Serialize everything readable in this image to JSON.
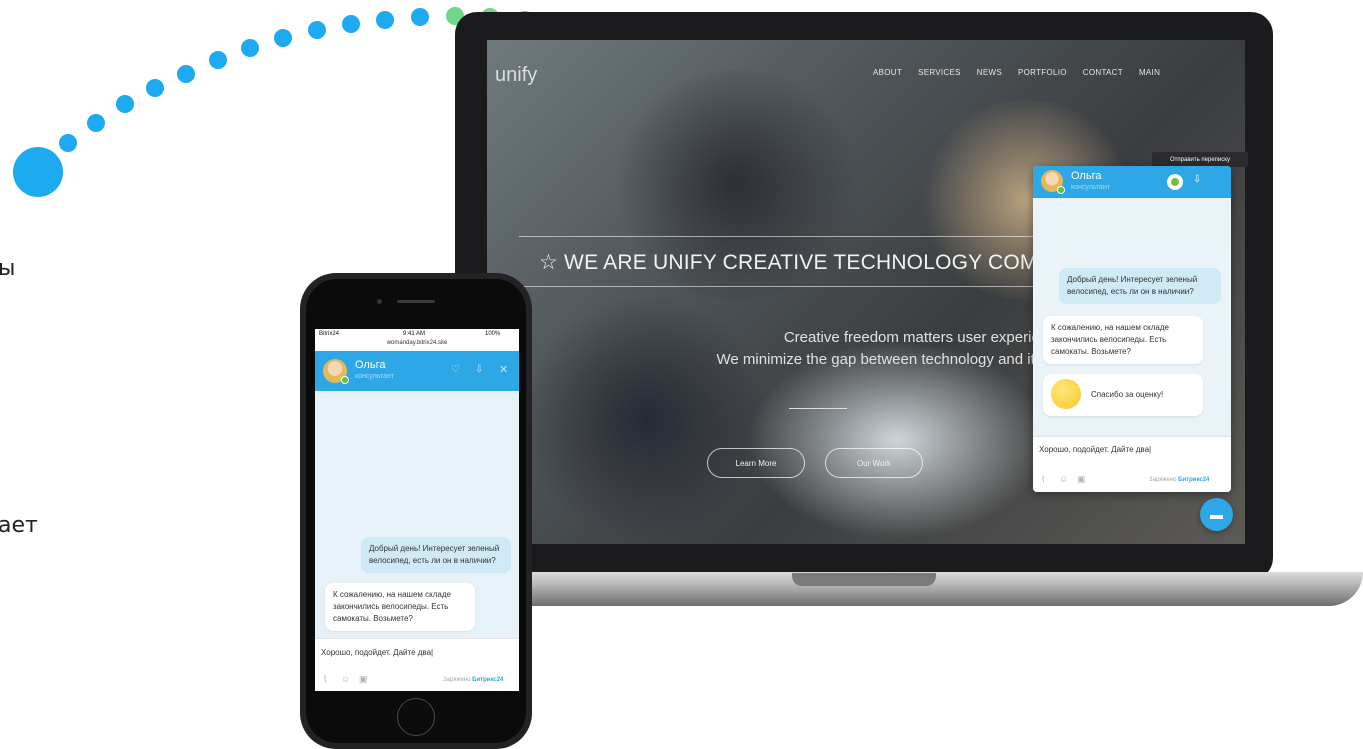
{
  "side_text": {
    "line1": "ы",
    "line2": "ает"
  },
  "website": {
    "logo": "unify",
    "nav": [
      "ABOUT",
      "SERVICES",
      "NEWS",
      "PORTFOLIO",
      "CONTACT",
      "MAIN"
    ],
    "hero_title": "☆ WE ARE UNIFY CREATIVE TECHNOLOGY COMP",
    "hero_sub1": "Creative freedom matters user experience.",
    "hero_sub2": "We minimize the gap between technology and its audience.",
    "btn_learn": "Learn More",
    "btn_work": "Our Work"
  },
  "laptop_chat": {
    "tooltip": "Отправить переписку",
    "operator_name": "Ольга",
    "operator_role": "консультант",
    "msg_out": "Добрый день! Интересует зеленый велосипед, есть ли он в наличии?",
    "msg_in": "К сожалению, на нашем складе закончились велосипеды. Есть самокаты. Возьмете?",
    "msg_rating": "Спасибо за оценку!",
    "input_text": "Хорошо, подойдет. Дайте два|",
    "powered_prefix": "Заряжено",
    "powered_brand": "Битрикс24"
  },
  "phone": {
    "status_carrier": "Bitrix24",
    "status_time": "9:41 AM",
    "status_battery": "100%",
    "url": "womanday.bitrix24.site",
    "operator_name": "Ольга",
    "operator_role": "консультант",
    "msg_out": "Добрый день! Интересует зеленый велосипед, есть ли он в наличии?",
    "msg_in": "К сожалению, на нашем складе закончились велосипеды. Есть самокаты. Возьмете?",
    "input_text": "Хорошо, подойдет. Дайте два|",
    "powered_prefix": "Заряжено",
    "powered_brand": "Битрикс24"
  },
  "colors": {
    "accent": "#2ea7e6",
    "dots_blue": "#1eaaf1",
    "dots_green": "#6fd68a"
  }
}
